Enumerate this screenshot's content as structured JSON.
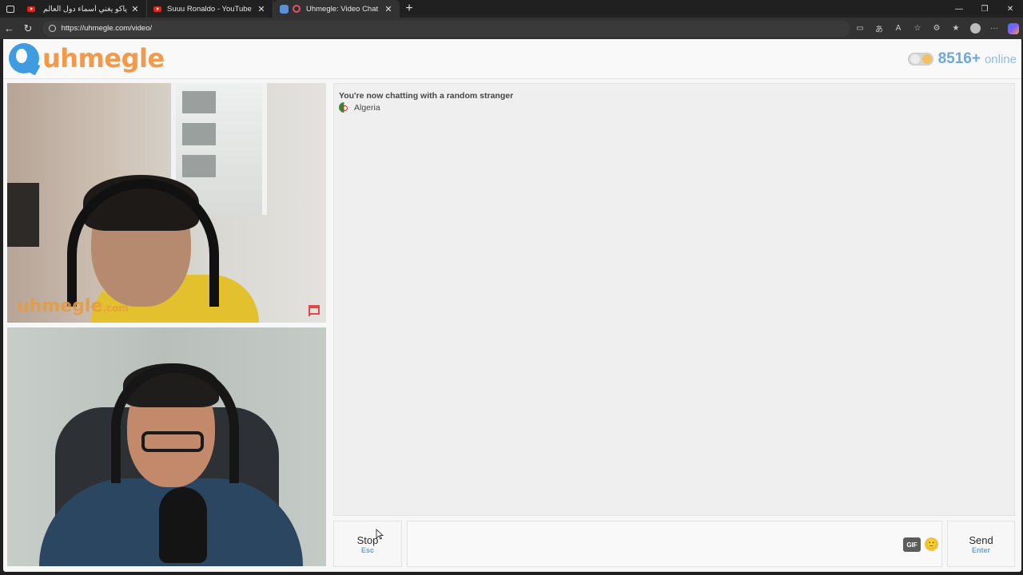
{
  "browser": {
    "tabs": [
      {
        "title": "ياكو يغني أسماء دول العالم | سينيت",
        "favicon": "youtube-icon",
        "active": false
      },
      {
        "title": "Suuu Ronaldo - YouTube",
        "favicon": "youtube-icon",
        "active": false
      },
      {
        "title": "Uhmegle: Video Chat | Omeg",
        "favicon": "uhmegle-icon",
        "active": true
      }
    ],
    "new_tab": "+",
    "url": "https://uhmegle.com/video/",
    "window_controls": {
      "minimize": "—",
      "restore": "❐",
      "close": "✕"
    },
    "nav": {
      "back": "←",
      "reload": "↻"
    }
  },
  "header": {
    "logo_text": "uhmegle",
    "online_count": "8516+",
    "online_label": "online",
    "theme_toggle": "on"
  },
  "videos": {
    "stranger_watermark": "uhmegle",
    "stranger_watermark_suffix": ".com"
  },
  "chat": {
    "status_message": "You're now chatting with a random stranger",
    "stranger_country": "Algeria"
  },
  "controls": {
    "stop_label": "Stop",
    "stop_key": "Esc",
    "message_placeholder": "",
    "gif_label": "GIF",
    "emoji": "🙂",
    "send_label": "Send",
    "send_key": "Enter"
  },
  "colors": {
    "brand_orange": "#f2994a",
    "brand_blue": "#3f9ce0",
    "online_blue": "#6fa8dc",
    "key_hint_blue": "#5fa6de"
  }
}
